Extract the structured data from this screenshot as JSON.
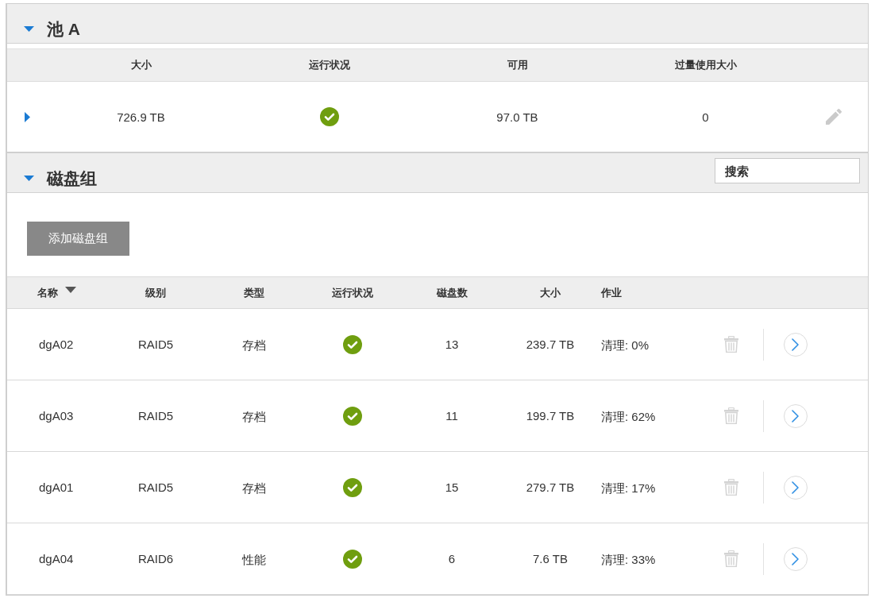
{
  "pool": {
    "title": "池 A",
    "expanded": true,
    "table": {
      "columns": [
        "大小",
        "运行状况",
        "可用",
        "过量使用大小"
      ],
      "row": {
        "expanded": false,
        "size": "726.9 TB",
        "healthy": true,
        "available": "97.0 TB",
        "overcommit": "0"
      }
    }
  },
  "disk_groups": {
    "title": "磁盘组",
    "expanded": true,
    "search": {
      "placeholder": "搜索"
    },
    "add_button": "添加磁盘组",
    "table": {
      "columns": [
        {
          "label": "名称",
          "sorted": true
        },
        {
          "label": "级别",
          "sorted": false
        },
        {
          "label": "类型",
          "sorted": false
        },
        {
          "label": "运行状况",
          "sorted": false
        },
        {
          "label": "磁盘数",
          "sorted": false
        },
        {
          "label": "大小",
          "sorted": false
        },
        {
          "label": "作业",
          "sorted": false
        }
      ],
      "rows": [
        {
          "name": "dgA02",
          "level": "RAID5",
          "type": "存档",
          "healthy": true,
          "disks": "13",
          "size": "239.7 TB",
          "job": "清理: 0%"
        },
        {
          "name": "dgA03",
          "level": "RAID5",
          "type": "存档",
          "healthy": true,
          "disks": "11",
          "size": "199.7 TB",
          "job": "清理: 62%"
        },
        {
          "name": "dgA01",
          "level": "RAID5",
          "type": "存档",
          "healthy": true,
          "disks": "15",
          "size": "279.7 TB",
          "job": "清理: 17%"
        },
        {
          "name": "dgA04",
          "level": "RAID6",
          "type": "性能",
          "healthy": true,
          "disks": "6",
          "size": "7.6 TB",
          "job": "清理: 33%"
        }
      ]
    }
  }
}
